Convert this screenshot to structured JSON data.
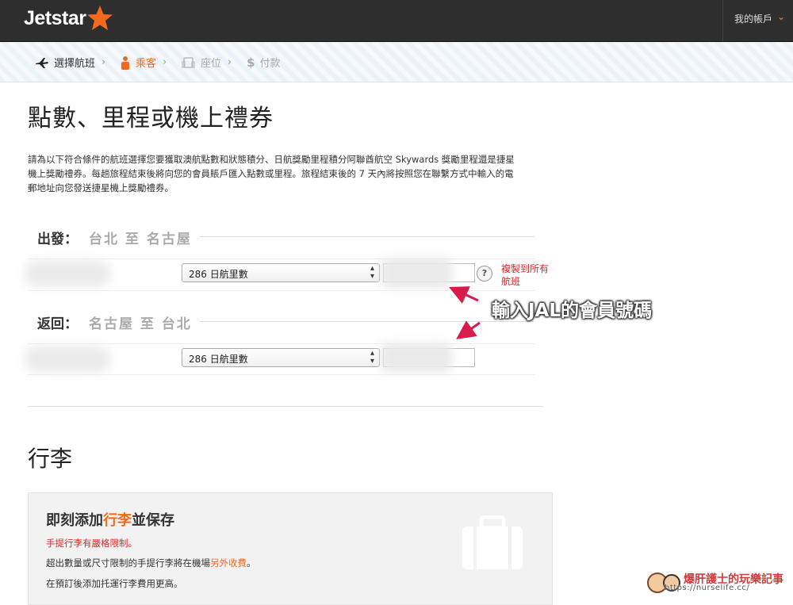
{
  "header": {
    "logo_text": "Jetstar",
    "account_label": "我的帳戶",
    "brand_color": "#f26b1d"
  },
  "steps": [
    {
      "label": "選擇航班",
      "icon": "plane-icon",
      "state": "done"
    },
    {
      "label": "乘客",
      "icon": "person-icon",
      "state": "active"
    },
    {
      "label": "座位",
      "icon": "seat-icon",
      "state": "disabled"
    },
    {
      "label": "付款",
      "icon": "dollar-icon",
      "state": "disabled"
    }
  ],
  "page": {
    "title": "點數、里程或機上禮券",
    "description": "請為以下符合條件的航班選擇您要獲取澳航點數和狀態積分、日航獎勵里程積分阿聯酋航空 Skywards 獎勵里程還是捷星機上獎勵禮券。每趟旅程結束後將向您的會員賬戶匯入點數或里程。旅程結束後的 7 天內將按照您在聯繫方式中輸入的電郵地址向您發送捷星機上獎勵禮券。"
  },
  "segments": [
    {
      "direction": "出發：",
      "route": "台北 至 名古屋",
      "select_value": "286 日航里數",
      "membership_value": ""
    },
    {
      "direction": "返回：",
      "route": "名古屋 至 台北",
      "select_value": "286 日航里數",
      "membership_value": ""
    }
  ],
  "help_symbol": "?",
  "copy_to_all": "複製到所有航班",
  "annotation": "輸入JAL的會員號碼",
  "baggage": {
    "section_title": "行李",
    "box_title_before": "即刻添加",
    "box_title_highlight": "行李",
    "box_title_after": "並保存",
    "warning": "手提行李有嚴格限制。",
    "line2_before": "超出數量或尺寸限制的手提行李將在機場",
    "line2_highlight": "另外收費",
    "line2_after": "。",
    "line3": "在預訂後添加托運行李費用更高。"
  },
  "watermark": {
    "text": "爆肝護士的玩樂記事",
    "url": "https://nurselife.cc/"
  }
}
